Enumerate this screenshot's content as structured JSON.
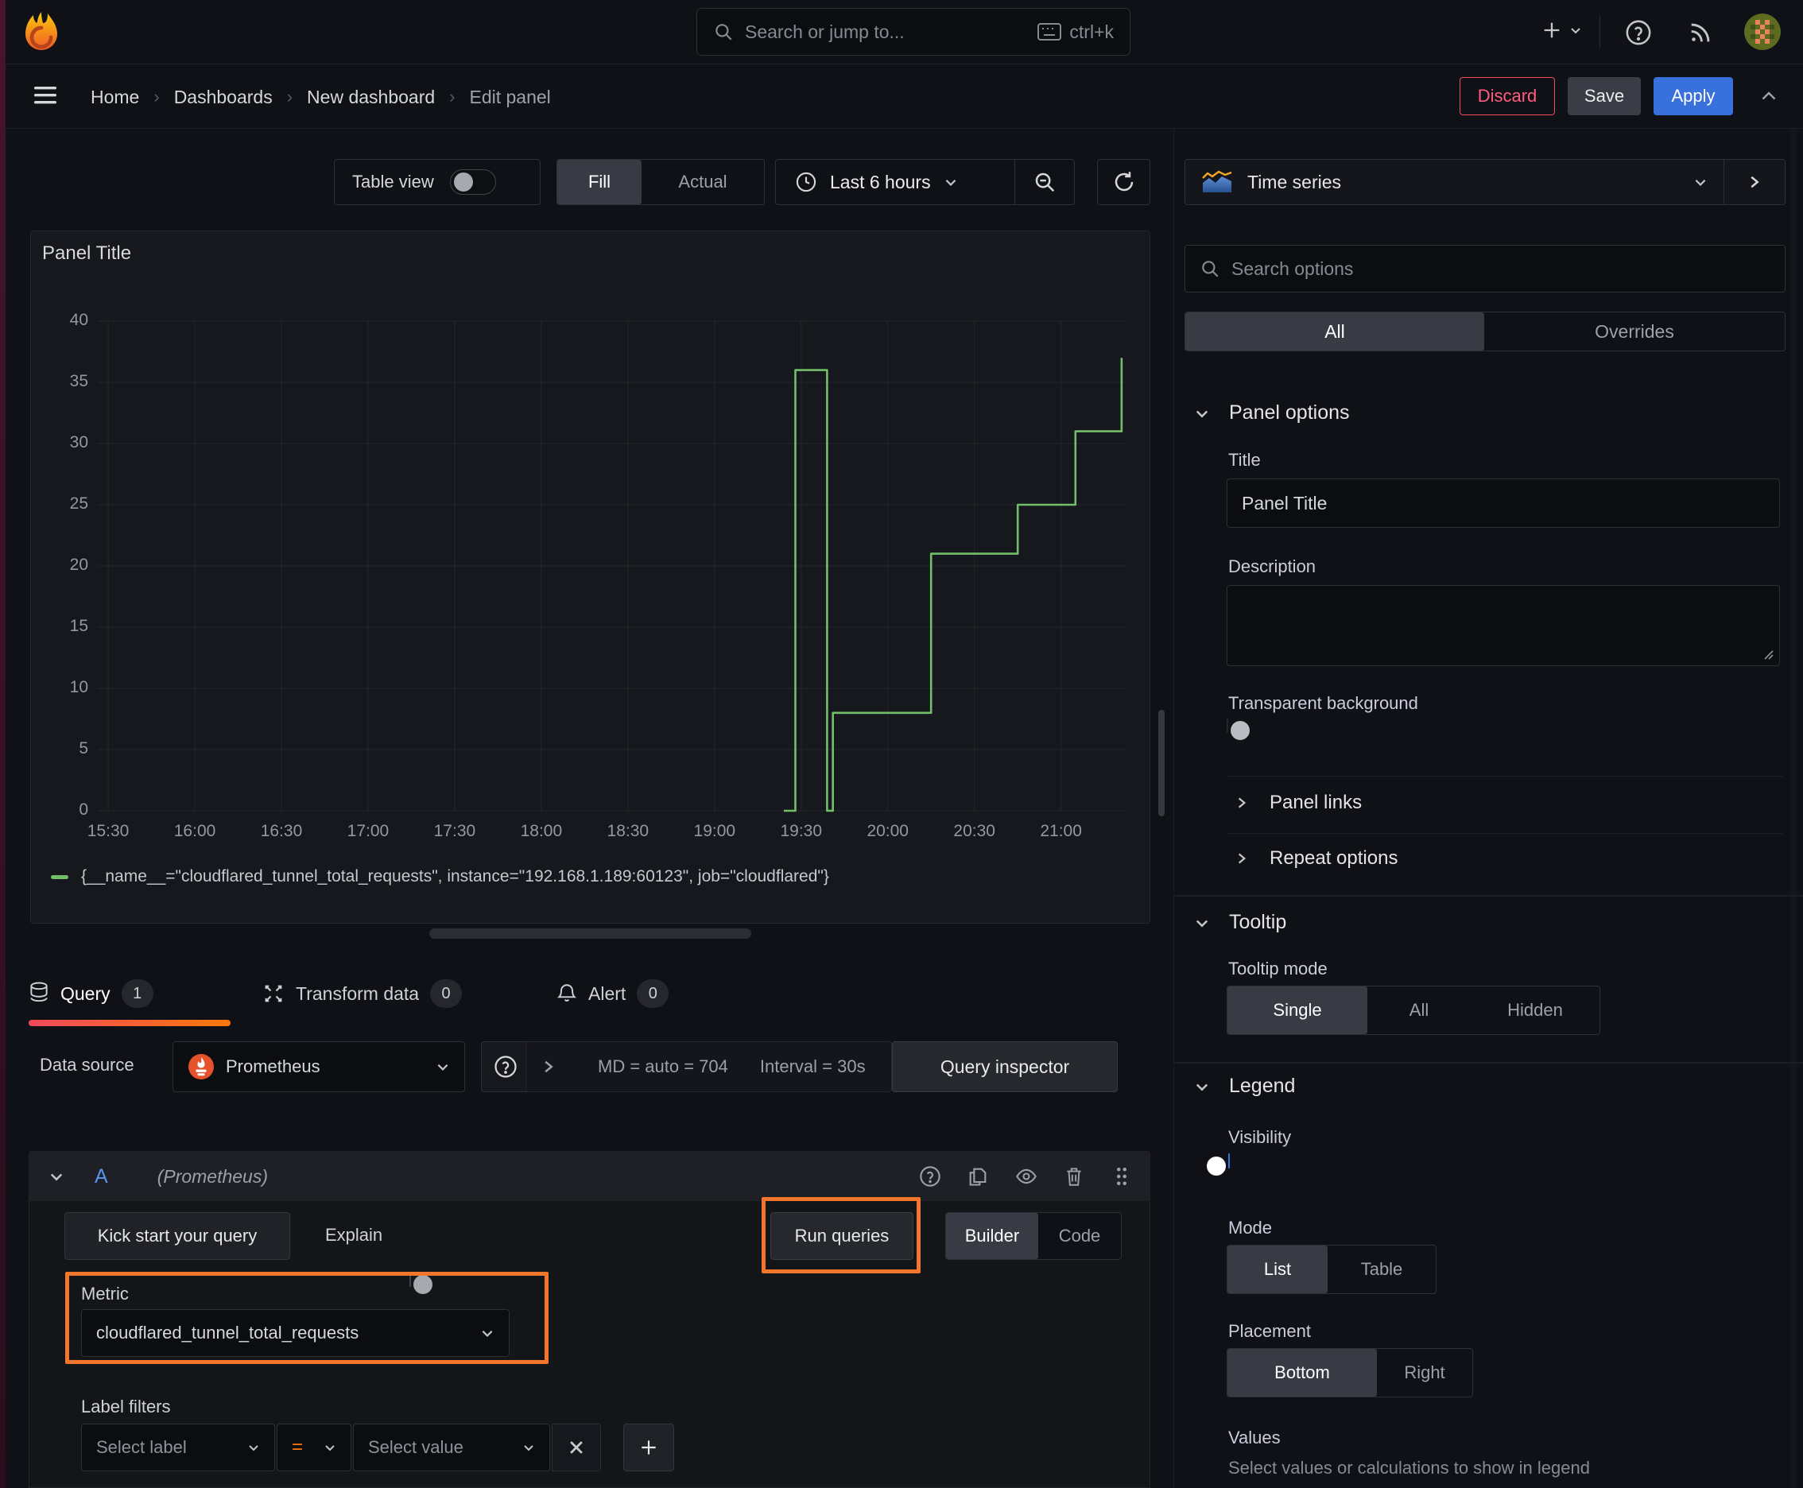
{
  "topbar": {
    "search": {
      "placeholder": "Search or jump to...",
      "shortcut": "ctrl+k"
    }
  },
  "breadcrumb": {
    "items": [
      "Home",
      "Dashboards",
      "New dashboard",
      "Edit panel"
    ]
  },
  "actions": {
    "discard": "Discard",
    "save": "Save",
    "apply": "Apply"
  },
  "toolbar": {
    "table_view_label": "Table view",
    "table_view_on": false,
    "fit_options": [
      "Fill",
      "Actual"
    ],
    "fit_selected": "Fill",
    "time_range": "Last 6 hours"
  },
  "panel": {
    "title": "Panel Title"
  },
  "chart_data": {
    "type": "line",
    "title": "Panel Title",
    "x_tick_labels": [
      "15:30",
      "16:00",
      "16:30",
      "17:00",
      "17:30",
      "18:00",
      "18:30",
      "19:00",
      "19:30",
      "20:00",
      "20:30",
      "21:00"
    ],
    "x_tick_minutes": [
      0,
      30,
      60,
      90,
      120,
      150,
      180,
      210,
      240,
      270,
      300,
      330
    ],
    "y_ticks": [
      0,
      5,
      10,
      15,
      20,
      25,
      30,
      35,
      40
    ],
    "ylim": [
      0,
      40
    ],
    "xlim_minutes": [
      -3.6,
      352.4
    ],
    "grid": true,
    "legend_position": "bottom",
    "series": [
      {
        "name": "{__name__=\"cloudflared_tunnel_total_requests\", instance=\"192.168.1.189:60123\", job=\"cloudflared\"}",
        "color": "#73bf69",
        "step_points_min_value": [
          [
            234,
            0
          ],
          [
            238,
            0
          ],
          [
            238,
            36
          ],
          [
            249,
            36
          ],
          [
            249,
            0
          ],
          [
            251,
            0
          ],
          [
            251,
            8
          ],
          [
            285,
            8
          ],
          [
            285,
            21
          ],
          [
            315,
            21
          ],
          [
            315,
            25
          ],
          [
            335,
            25
          ],
          [
            335,
            31
          ],
          [
            351,
            31
          ],
          [
            351,
            37
          ]
        ]
      }
    ]
  },
  "tabs": [
    {
      "label": "Query",
      "count": "1",
      "active": true
    },
    {
      "label": "Transform data",
      "count": "0",
      "active": false
    },
    {
      "label": "Alert",
      "count": "0",
      "active": false
    }
  ],
  "datasource": {
    "label": "Data source",
    "name": "Prometheus",
    "stats": {
      "md": "MD = auto = 704",
      "interval": "Interval = 30s"
    },
    "inspector": "Query inspector"
  },
  "query": {
    "ref_id": "A",
    "ds_hint": "(Prometheus)",
    "kick_start": "Kick start your query",
    "explain": "Explain",
    "explain_on": false,
    "run": "Run queries",
    "editor_modes": [
      "Builder",
      "Code"
    ],
    "editor_selected": "Builder",
    "metric": {
      "label": "Metric",
      "value": "cloudflared_tunnel_total_requests"
    },
    "label_filters": {
      "label": "Label filters",
      "select_label": "Select label",
      "operator": "=",
      "select_value": "Select value"
    }
  },
  "sidebar": {
    "visualization": "Time series",
    "search_placeholder": "Search options",
    "scope_tabs": [
      "All",
      "Overrides"
    ],
    "scope_selected": "All",
    "panel_options": {
      "title": "Panel options",
      "title_label": "Title",
      "title_value": "Panel Title",
      "description_label": "Description",
      "transparent_label": "Transparent background",
      "transparent_on": false,
      "links": "Panel links",
      "repeat": "Repeat options"
    },
    "tooltip": {
      "title": "Tooltip",
      "mode_label": "Tooltip mode",
      "modes": [
        "Single",
        "All",
        "Hidden"
      ],
      "selected": "Single"
    },
    "legend": {
      "title": "Legend",
      "visibility_label": "Visibility",
      "visibility_on": true,
      "mode_label": "Mode",
      "modes": [
        "List",
        "Table"
      ],
      "mode_selected": "List",
      "placement_label": "Placement",
      "placements": [
        "Bottom",
        "Right"
      ],
      "placement_selected": "Bottom",
      "values_label": "Values",
      "values_hint": "Select values or calculations to show in legend"
    }
  },
  "colors": {
    "accent_orange": "#ff780a",
    "annotation_orange": "#f2762b",
    "series_green": "#73bf69",
    "primary_blue": "#3871dc",
    "destructive_red": "#f2495c",
    "ref_id_blue": "#5794f2"
  }
}
